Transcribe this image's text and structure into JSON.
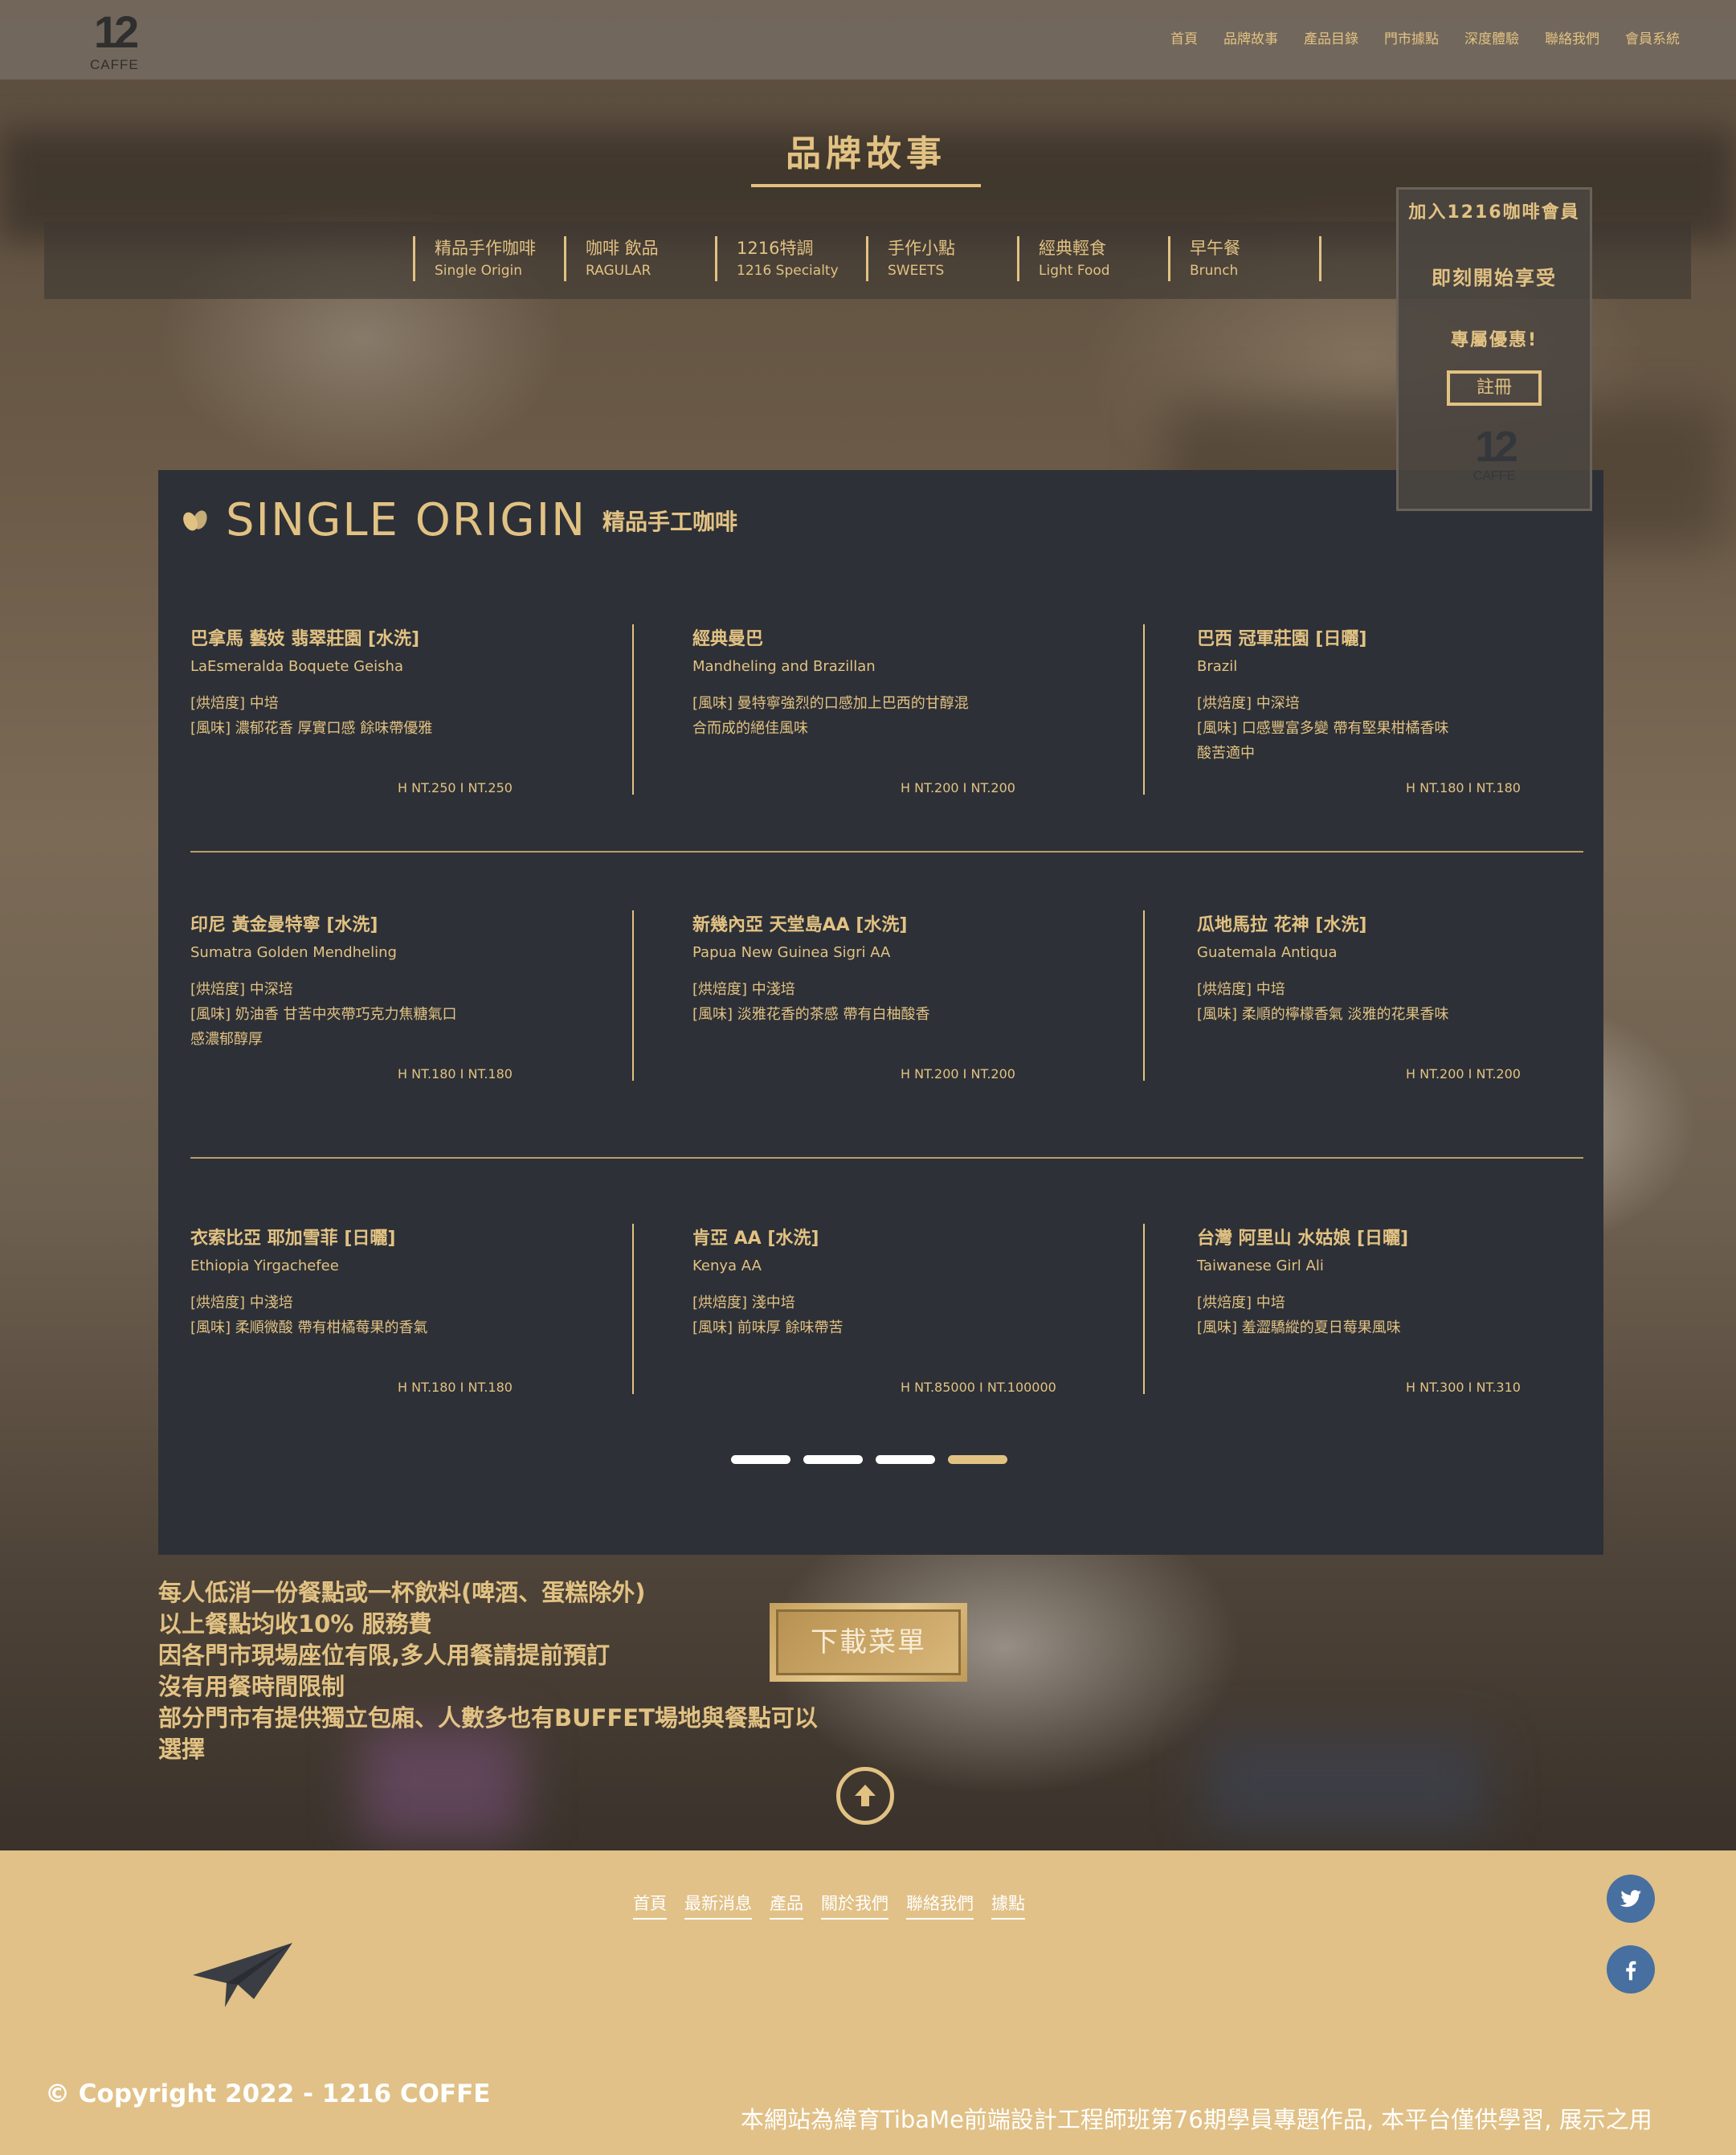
{
  "header": {
    "logo_num": "12",
    "logo_text": "CAFFE",
    "nav": [
      "首頁",
      "品牌故事",
      "產品目錄",
      "門市據點",
      "深度體驗",
      "聯絡我們",
      "會員系統"
    ]
  },
  "page_title": "品牌故事",
  "categories": [
    {
      "zh": "精品手作咖啡",
      "en": "Single Origin"
    },
    {
      "zh": "咖啡 飲品",
      "en": "RAGULAR"
    },
    {
      "zh": "1216特調",
      "en": "1216 Specialty"
    },
    {
      "zh": "手作小點",
      "en": "SWEETS"
    },
    {
      "zh": "經典輕食",
      "en": "Light Food"
    },
    {
      "zh": "早午餐",
      "en": "Brunch"
    }
  ],
  "member": {
    "line1": "加入1216咖啡會員",
    "line2": "即刻開始享受",
    "line3": "專屬優惠!",
    "register": "註冊",
    "logo_num": "12",
    "logo_text": "CAFFE"
  },
  "menu": {
    "title": "SINGLE ORIGIN",
    "subtitle": "精品手工咖啡",
    "items": [
      {
        "name": "巴拿馬 藝妓 翡翠莊園 [水洗]",
        "en": "LaEsmeralda Boquete Geisha",
        "lines": [
          "[烘焙度] 中培",
          "[風味] 濃郁花香 厚實口感 餘味帶優雅"
        ],
        "price": "H NT.250 I NT.250"
      },
      {
        "name": "經典曼巴",
        "en": "Mandheling and Brazillan",
        "lines": [
          "[風味] 曼特寧強烈的口感加上巴西的甘醇混",
          "合而成的絕佳風味"
        ],
        "price": "H NT.200 I NT.200"
      },
      {
        "name": "巴西 冠軍莊園 [日曬]",
        "en": "Brazil",
        "lines": [
          "[烘焙度] 中深培",
          "[風味] 口感豐富多變 帶有堅果柑橘香味",
          "酸苦適中"
        ],
        "price": "H NT.180 I NT.180"
      },
      {
        "name": "印尼 黃金曼特寧 [水洗]",
        "en": "Sumatra Golden Mendheling",
        "lines": [
          "[烘焙度] 中深培",
          "[風味] 奶油香 甘苦中夾帶巧克力焦糖氣口",
          "感濃郁醇厚"
        ],
        "price": "H NT.180 I NT.180"
      },
      {
        "name": "新幾內亞 天堂島AA [水洗]",
        "en": "Papua New Guinea Sigri AA",
        "lines": [
          "[烘焙度] 中淺培",
          "[風味] 淡雅花香的茶感 帶有白柚酸香"
        ],
        "price": "H NT.200 I NT.200"
      },
      {
        "name": "瓜地馬拉 花神 [水洗]",
        "en": "Guatemala Antiqua",
        "lines": [
          "[烘焙度] 中培",
          "[風味] 柔順的檸檬香氣 淡雅的花果香味"
        ],
        "price": "H NT.200 I NT.200"
      },
      {
        "name": "衣索比亞 耶加雪菲 [日曬]",
        "en": "Ethiopia Yirgachefee",
        "lines": [
          "[烘焙度] 中淺培",
          "[風味] 柔順微酸 帶有柑橘莓果的香氣"
        ],
        "price": "H NT.180 I NT.180"
      },
      {
        "name": "肯亞 AA [水洗]",
        "en": "Kenya AA",
        "lines": [
          "[烘焙度] 淺中培",
          "[風味] 前味厚 餘味帶苦"
        ],
        "price": "H NT.85000 I NT.100000"
      },
      {
        "name": "台灣 阿里山 水姑娘 [日曬]",
        "en": "Taiwanese Girl Ali",
        "lines": [
          "[烘焙度] 中培",
          "[風味] 羞澀驕縱的夏日莓果風味"
        ],
        "price": "H NT.300 I NT.310"
      }
    ],
    "pagination": {
      "pages": 4,
      "active": 4
    }
  },
  "notes": [
    "每人低消一份餐點或一杯飲料(啤酒、蛋糕除外)",
    "以上餐點均收10% 服務費",
    "因各門市現場座位有限,多人用餐請提前預訂",
    "沒有用餐時間限制",
    "部分門市有提供獨立包廂、人數多也有BUFFET場地與餐點可以",
    "選擇"
  ],
  "download_button": "下載菜單",
  "footer": {
    "nav": [
      "首頁",
      "最新消息",
      "產品",
      "關於我們",
      "聯絡我們",
      "據點"
    ],
    "copyright": "© Copyright 2022 - 1216 COFFE",
    "disclaimer": "本網站為緯育TibaMe前端設計工程師班第76期學員專題作品, 本平台僅供學習, 展示之用",
    "social": [
      "twitter-icon",
      "facebook-icon"
    ]
  },
  "colors": {
    "accent": "#e2c283",
    "panel": "#2d3036",
    "footer": "#e1c187",
    "social": "#476fa0"
  }
}
